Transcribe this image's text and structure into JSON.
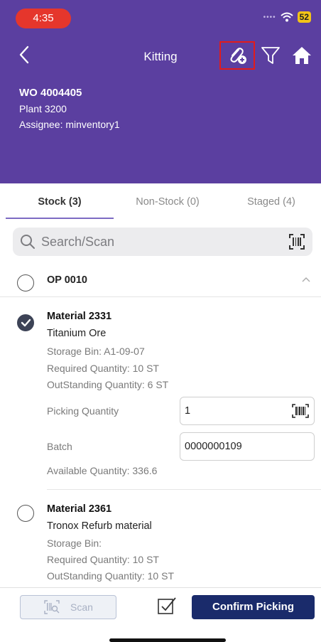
{
  "status_bar": {
    "time": "4:35",
    "battery": "52"
  },
  "header": {
    "title": "Kitting",
    "work_order": "WO 4004405",
    "plant": "Plant 3200",
    "assignee": "Assignee: minventory1"
  },
  "tabs": [
    {
      "label": "Stock (3)",
      "active": true
    },
    {
      "label": "Non-Stock (0)",
      "active": false
    },
    {
      "label": "Staged (4)",
      "active": false
    }
  ],
  "search": {
    "placeholder": "Search/Scan"
  },
  "operation": {
    "label": "OP 0010"
  },
  "materials": [
    {
      "title": "Material 2331",
      "description": "Titanium Ore",
      "storage_bin": "Storage Bin: A1-09-07",
      "required_qty": "Required Quantity: 10 ST",
      "outstanding_qty": "OutStanding Quantity: 6 ST",
      "picking_label": "Picking Quantity",
      "picking_value": "1",
      "batch_label": "Batch",
      "batch_value": "0000000109",
      "available_qty": "Available Quantity: 336.6",
      "checked": true
    },
    {
      "title": "Material 2361",
      "description": "Tronox Refurb material",
      "storage_bin": "Storage Bin:",
      "required_qty": "Required Quantity: 10 ST",
      "outstanding_qty": "OutStanding Quantity: 10 ST",
      "checked": false
    }
  ],
  "bottom_bar": {
    "scan_label": "Scan",
    "confirm_label": "Confirm Picking"
  },
  "colors": {
    "header_bg": "#5b3fa0",
    "accent": "#1a2b6b",
    "highlight_box": "#e21b1b"
  }
}
